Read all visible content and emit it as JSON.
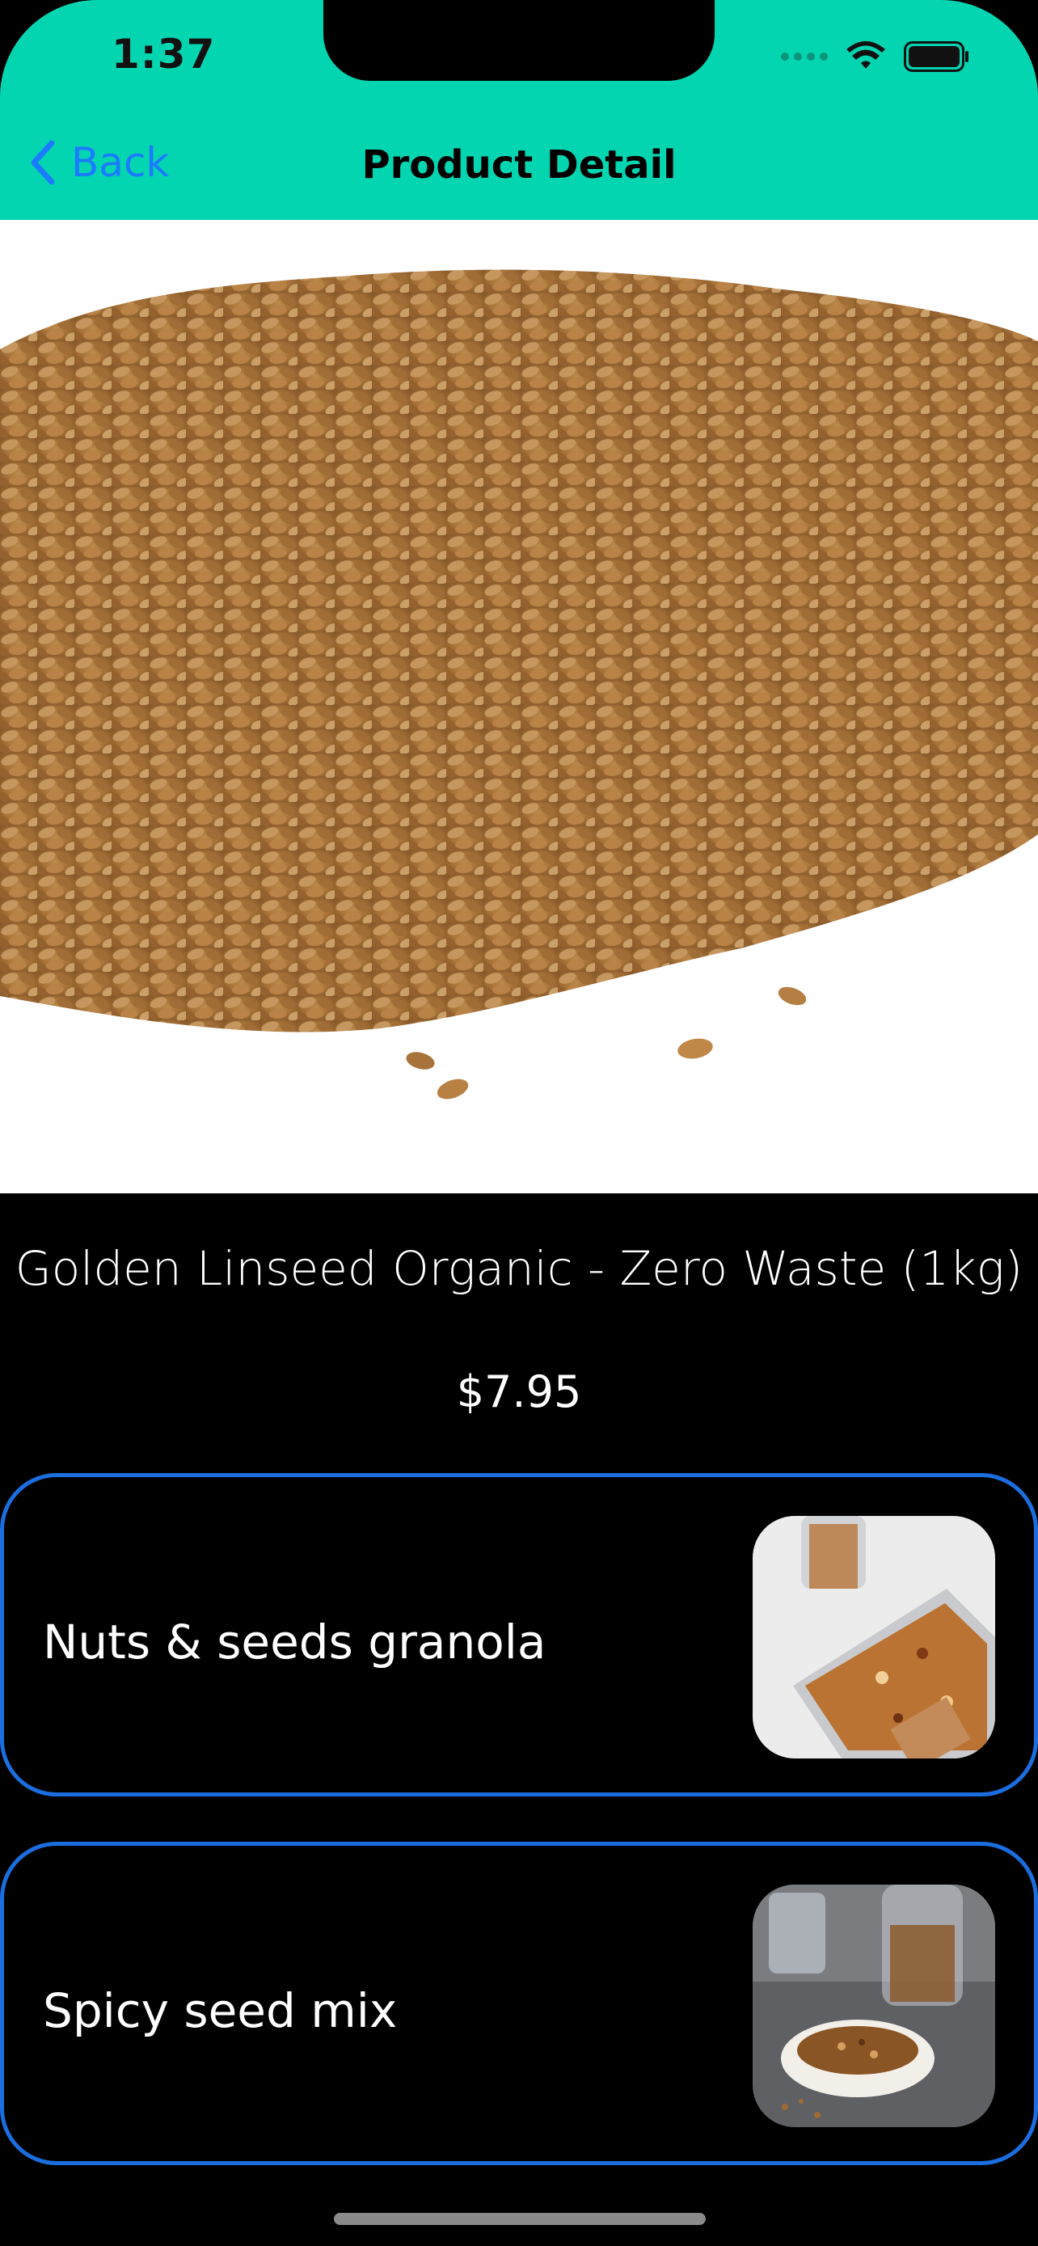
{
  "status_bar": {
    "time": "1:37"
  },
  "nav": {
    "back_label": "Back",
    "title": "Product Detail"
  },
  "product": {
    "name": "Golden Linseed Organic - Zero Waste (1kg)",
    "price": "$7.95"
  },
  "recipes": [
    {
      "label": "Nuts & seeds granola"
    },
    {
      "label": "Spicy seed mix"
    }
  ],
  "colors": {
    "header_bg": "#03D5B0",
    "accent_blue": "#1B7BFF",
    "card_border": "#1B6EE0",
    "background": "#000000"
  }
}
